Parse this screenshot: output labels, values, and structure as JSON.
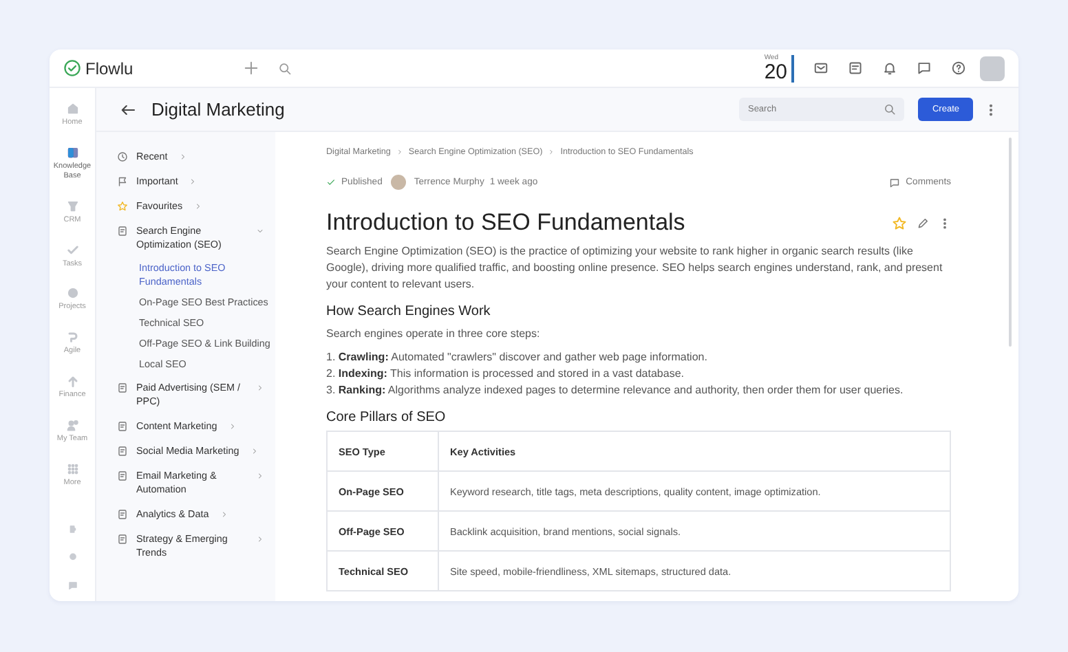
{
  "app": {
    "name": "Flowlu"
  },
  "date": {
    "weekday": "Wed",
    "day": "20"
  },
  "rail": [
    {
      "label": "Home",
      "selected": false
    },
    {
      "label": "Knowledge Base",
      "selected": true
    },
    {
      "label": "CRM",
      "selected": false
    },
    {
      "label": "Tasks",
      "selected": false
    },
    {
      "label": "Projects",
      "selected": false
    },
    {
      "label": "Agile",
      "selected": false
    },
    {
      "label": "Finance",
      "selected": false
    },
    {
      "label": "My Team",
      "selected": false
    },
    {
      "label": "More",
      "selected": false
    }
  ],
  "header": {
    "title": "Digital Marketing",
    "search": {
      "placeholder": "Search"
    },
    "create": "Create"
  },
  "tree": [
    {
      "label": "Recent",
      "kind": "recent",
      "expanded": false
    },
    {
      "label": "Important",
      "kind": "important",
      "expanded": false
    },
    {
      "label": "Favourites",
      "kind": "favourites",
      "expanded": false
    },
    {
      "label": "Search Engine Optimization (SEO)",
      "kind": "doc",
      "expanded": true,
      "children": [
        {
          "label": "Introduction to SEO Fundamentals",
          "selected": true
        },
        {
          "label": "On-Page SEO Best Practices",
          "selected": false
        },
        {
          "label": "Technical SEO",
          "selected": false
        },
        {
          "label": "Off-Page SEO & Link Building",
          "selected": false
        },
        {
          "label": "Local SEO",
          "selected": false
        }
      ]
    },
    {
      "label": "Paid Advertising (SEM / PPC)",
      "kind": "doc",
      "expanded": false
    },
    {
      "label": "Content Marketing",
      "kind": "doc",
      "expanded": false
    },
    {
      "label": "Social Media Marketing",
      "kind": "doc",
      "expanded": false
    },
    {
      "label": "Email Marketing & Automation",
      "kind": "doc",
      "expanded": false
    },
    {
      "label": "Analytics & Data",
      "kind": "doc",
      "expanded": false
    },
    {
      "label": "Strategy & Emerging Trends",
      "kind": "doc",
      "expanded": false
    }
  ],
  "breadcrumbs": [
    "Digital Marketing",
    "Search Engine Optimization (SEO)",
    "Introduction to SEO Fundamentals"
  ],
  "meta": {
    "status": "Published",
    "author": "Terrence Murphy",
    "time": "1 week ago",
    "comments": "Comments"
  },
  "article": {
    "title": "Introduction to SEO Fundamentals",
    "favourite": true,
    "intro": "Search Engine Optimization (SEO) is the practice of optimizing your website to rank higher in organic search results (like Google), driving more qualified traffic, and boosting online presence. SEO helps search engines understand, rank, and present your content to relevant users.",
    "sections": [
      {
        "heading": "How Search Engines Work",
        "text": "Search engines operate in three core steps:",
        "steps": [
          "1. **Crawling:** Automated \"crawlers\" discover and gather web page information.",
          "2. **Indexing:** This information is processed and stored in a vast database.",
          "3. **Ranking:** Algorithms analyze indexed pages to determine relevance and authority, then order them for user queries."
        ]
      },
      {
        "heading": "Core Pillars of SEO",
        "table": {
          "columns": [
            "SEO Type",
            "Key Activities"
          ],
          "rows": [
            [
              "On-Page SEO",
              "Keyword research, title tags, meta descriptions, quality content, image optimization."
            ],
            [
              "Off-Page SEO",
              "Backlink acquisition, brand mentions, social signals."
            ],
            [
              "Technical SEO",
              "Site speed, mobile-friendliness, XML sitemaps, structured data."
            ]
          ]
        }
      }
    ]
  }
}
